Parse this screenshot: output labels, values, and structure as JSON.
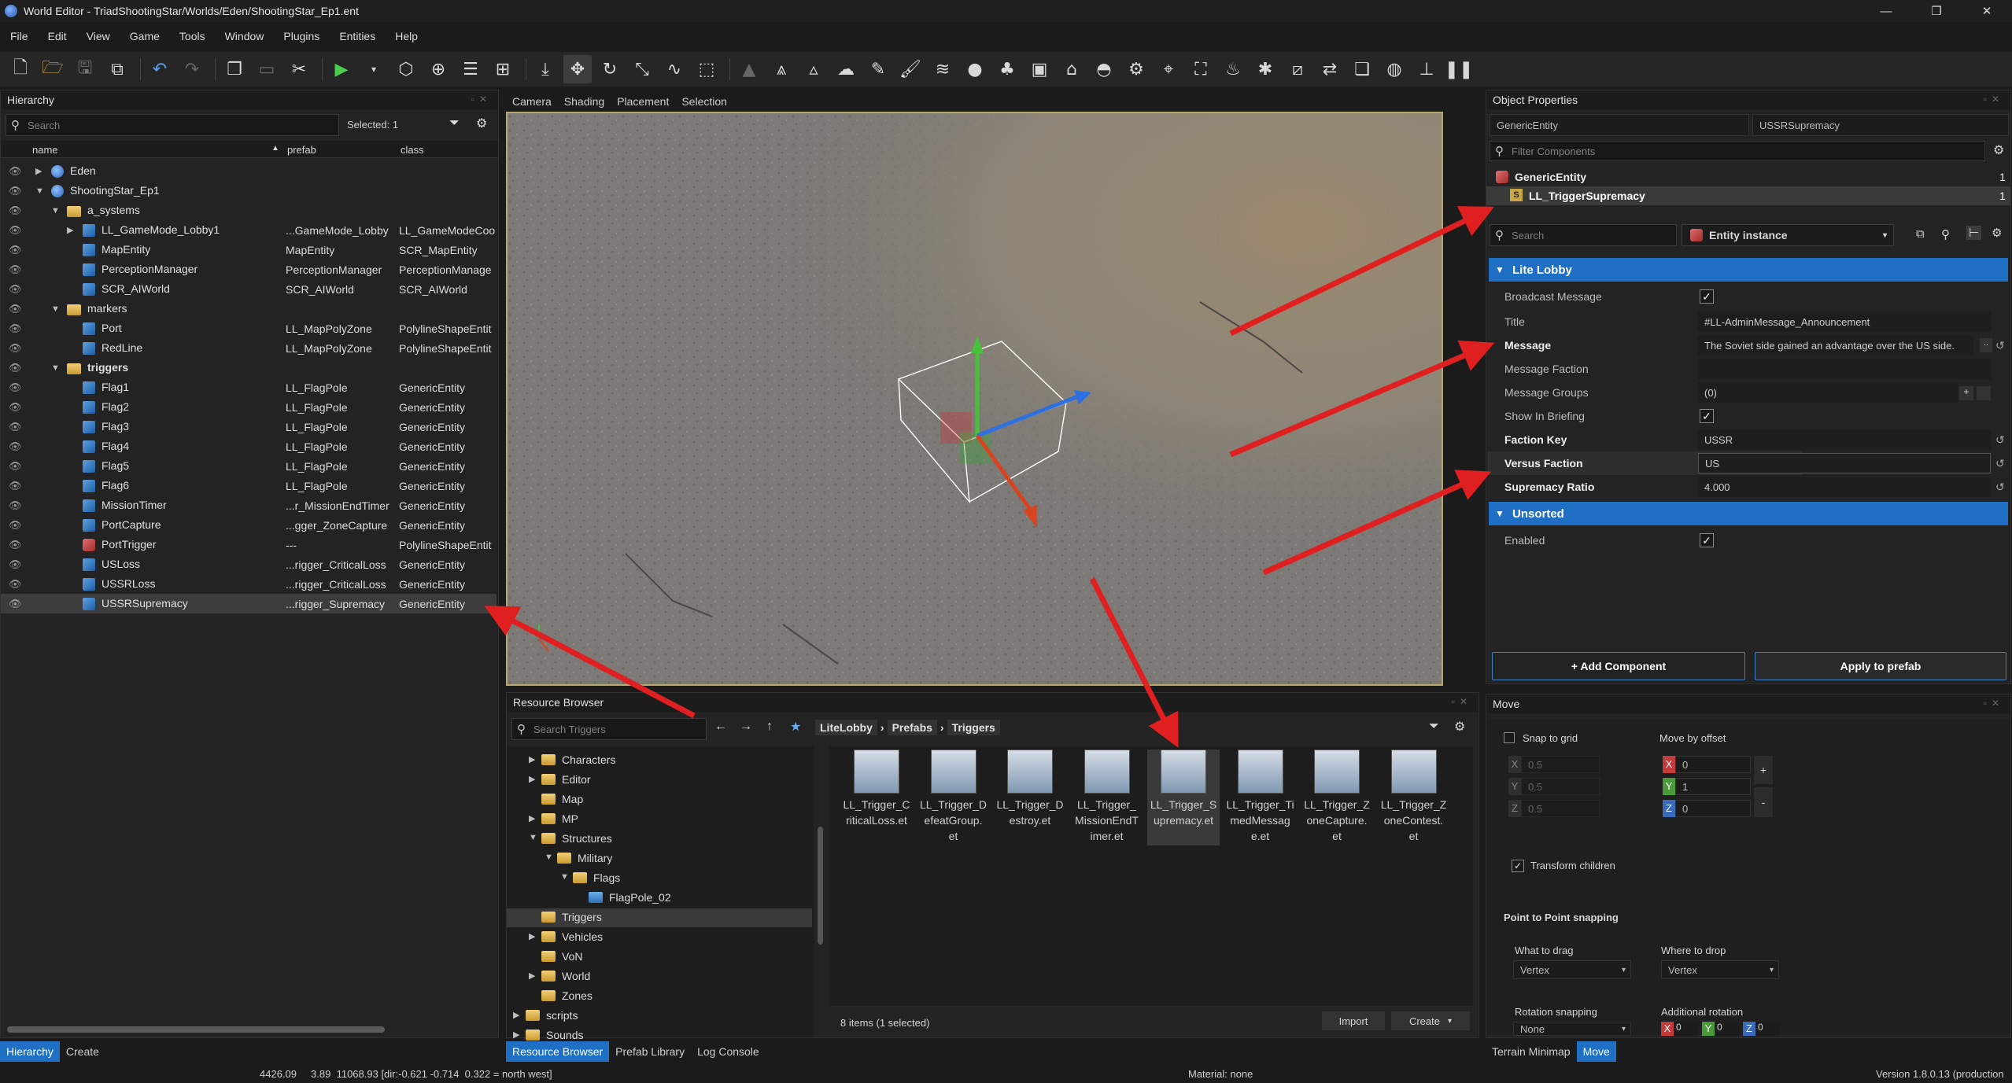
{
  "window": {
    "title": "World Editor - TriadShootingStar/Worlds/Eden/ShootingStar_Ep1.ent"
  },
  "menu": [
    "File",
    "Edit",
    "View",
    "Game",
    "Tools",
    "Window",
    "Plugins",
    "Entities",
    "Help"
  ],
  "hierarchy": {
    "title": "Hierarchy",
    "search_placeholder": "Search",
    "selected": "Selected: 1",
    "columns": [
      "name",
      "prefab",
      "class"
    ],
    "rows": [
      {
        "name": "Eden",
        "prefab": "",
        "cls": ""
      },
      {
        "name": "ShootingStar_Ep1",
        "prefab": "",
        "cls": ""
      },
      {
        "name": "a_systems",
        "prefab": "",
        "cls": ""
      },
      {
        "name": "LL_GameMode_Lobby1",
        "prefab": "...GameMode_Lobby",
        "cls": "LL_GameModeCoo"
      },
      {
        "name": "MapEntity",
        "prefab": "MapEntity",
        "cls": "SCR_MapEntity"
      },
      {
        "name": "PerceptionManager",
        "prefab": "PerceptionManager",
        "cls": "PerceptionManage"
      },
      {
        "name": "SCR_AIWorld",
        "prefab": "SCR_AIWorld",
        "cls": "SCR_AIWorld"
      },
      {
        "name": "markers",
        "prefab": "",
        "cls": ""
      },
      {
        "name": "Port",
        "prefab": "LL_MapPolyZone",
        "cls": "PolylineShapeEntit"
      },
      {
        "name": "RedLine",
        "prefab": "LL_MapPolyZone",
        "cls": "PolylineShapeEntit"
      },
      {
        "name": "triggers",
        "prefab": "",
        "cls": ""
      },
      {
        "name": "Flag1",
        "prefab": "LL_FlagPole",
        "cls": "GenericEntity"
      },
      {
        "name": "Flag2",
        "prefab": "LL_FlagPole",
        "cls": "GenericEntity"
      },
      {
        "name": "Flag3",
        "prefab": "LL_FlagPole",
        "cls": "GenericEntity"
      },
      {
        "name": "Flag4",
        "prefab": "LL_FlagPole",
        "cls": "GenericEntity"
      },
      {
        "name": "Flag5",
        "prefab": "LL_FlagPole",
        "cls": "GenericEntity"
      },
      {
        "name": "Flag6",
        "prefab": "LL_FlagPole",
        "cls": "GenericEntity"
      },
      {
        "name": "MissionTimer",
        "prefab": "...r_MissionEndTimer",
        "cls": "GenericEntity"
      },
      {
        "name": "PortCapture",
        "prefab": "...gger_ZoneCapture",
        "cls": "GenericEntity"
      },
      {
        "name": "PortTrigger",
        "prefab": "---",
        "cls": "PolylineShapeEntit"
      },
      {
        "name": "USLoss",
        "prefab": "...rigger_CriticalLoss",
        "cls": "GenericEntity"
      },
      {
        "name": "USSRLoss",
        "prefab": "...rigger_CriticalLoss",
        "cls": "GenericEntity"
      },
      {
        "name": "USSRSupremacy",
        "prefab": "...rigger_Supremacy",
        "cls": "GenericEntity"
      }
    ]
  },
  "viewport": {
    "tabs": [
      "Camera",
      "Shading",
      "Placement",
      "Selection"
    ]
  },
  "resource_browser": {
    "title": "Resource Browser",
    "search_placeholder": "Search Triggers",
    "breadcrumb": [
      "LiteLobby",
      "Prefabs",
      "Triggers"
    ],
    "tree": [
      "Characters",
      "Editor",
      "Map",
      "MP",
      "Structures",
      "Military",
      "Flags",
      "FlagPole_02",
      "Triggers",
      "Vehicles",
      "VoN",
      "World",
      "Zones",
      "scripts",
      "Sounds"
    ],
    "files": [
      {
        "l1": "LL_Trigger_C",
        "l2": "riticalLoss.et",
        "l3": ""
      },
      {
        "l1": "LL_Trigger_D",
        "l2": "efeatGroup.",
        "l3": "et"
      },
      {
        "l1": "LL_Trigger_D",
        "l2": "estroy.et",
        "l3": ""
      },
      {
        "l1": "LL_Trigger_",
        "l2": "MissionEndT",
        "l3": "imer.et"
      },
      {
        "l1": "LL_Trigger_S",
        "l2": "upremacy.et",
        "l3": ""
      },
      {
        "l1": "LL_Trigger_Ti",
        "l2": "medMessag",
        "l3": "e.et"
      },
      {
        "l1": "LL_Trigger_Z",
        "l2": "oneCapture.",
        "l3": "et"
      },
      {
        "l1": "LL_Trigger_Z",
        "l2": "oneContest.",
        "l3": "et"
      }
    ],
    "count": "8 items (1 selected)",
    "import": "Import",
    "create": "Create"
  },
  "object_properties": {
    "title": "Object Properties",
    "entity_type": "GenericEntity",
    "entity_name": "USSRSupremacy",
    "filter_placeholder": "Filter Components",
    "components": [
      {
        "name": "GenericEntity",
        "count": "1"
      },
      {
        "name": "LL_TriggerSupremacy",
        "count": "1"
      }
    ],
    "search_placeholder": "Search",
    "instance": "Entity instance",
    "section1": "Lite Lobby",
    "props": {
      "broadcast": "Broadcast Message",
      "title_l": "Title",
      "title_v": "#LL-AdminMessage_Announcement",
      "message_l": "Message",
      "message_v": "The Soviet side gained an advantage over the US side.",
      "mfaction_l": "Message Faction",
      "mgroups_l": "Message Groups",
      "mgroups_v": "(0)",
      "briefing_l": "Show In Briefing",
      "fkey_l": "Faction Key",
      "fkey_v": "USSR",
      "vfaction_l": "Versus Faction",
      "vfaction_v": "US",
      "sratio_l": "Supremacy Ratio",
      "sratio_v": "4.000"
    },
    "section2": "Unsorted",
    "enabled": "Enabled",
    "add_component": "+ Add Component",
    "apply_prefab": "Apply to prefab"
  },
  "move": {
    "title": "Move",
    "snap": "Snap to grid",
    "offset_title": "Move by offset",
    "grid_vals": [
      "0.5",
      "0.5",
      "0.5"
    ],
    "offset_vals": [
      "0",
      "1",
      "0"
    ],
    "transform_children": "Transform children",
    "p2p": "Point to Point snapping",
    "what_drag": "What to drag",
    "what_drag_v": "Vertex",
    "where_drop": "Where to drop",
    "where_drop_v": "Vertex",
    "rot_snap": "Rotation snapping",
    "rot_snap_v": "None",
    "add_rot": "Additional rotation",
    "add_rot_vals": [
      "0",
      "0",
      "0"
    ]
  },
  "bottom_tabs": {
    "left": [
      "Hierarchy",
      "Create"
    ],
    "middle": [
      "Resource Browser",
      "Prefab Library",
      "Log Console"
    ],
    "right": [
      "Terrain Minimap",
      "Move"
    ]
  },
  "status": {
    "coords": "4426.09     3.89  11068.93 [dir:-0.621 -0.714  0.322 = north west]",
    "material": "Material: none",
    "version": "Version 1.8.0.13 (production"
  },
  "colors": {
    "accent": "#1f70c4",
    "arrow": "#e02020",
    "selection_border": "#b6a86a"
  }
}
